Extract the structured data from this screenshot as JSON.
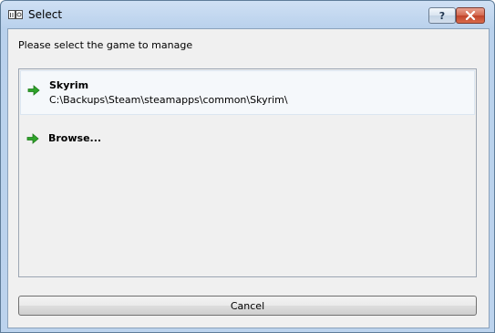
{
  "window": {
    "title": "Select",
    "icon": "mo-app-icon",
    "help_button": "?",
    "close_button": "close-icon"
  },
  "prompt": "Please select the game to manage",
  "games": [
    {
      "name": "Skyrim",
      "path": "C:\\Backups\\Steam\\steamapps\\common\\Skyrim\\",
      "icon": "green-arrow-icon",
      "selected": true
    }
  ],
  "browse": {
    "label": "Browse...",
    "icon": "green-arrow-icon"
  },
  "cancel_label": "Cancel",
  "colors": {
    "arrow": "#2fa42a",
    "titlebar": "#b9d1ec",
    "close_button": "#c0432a"
  }
}
